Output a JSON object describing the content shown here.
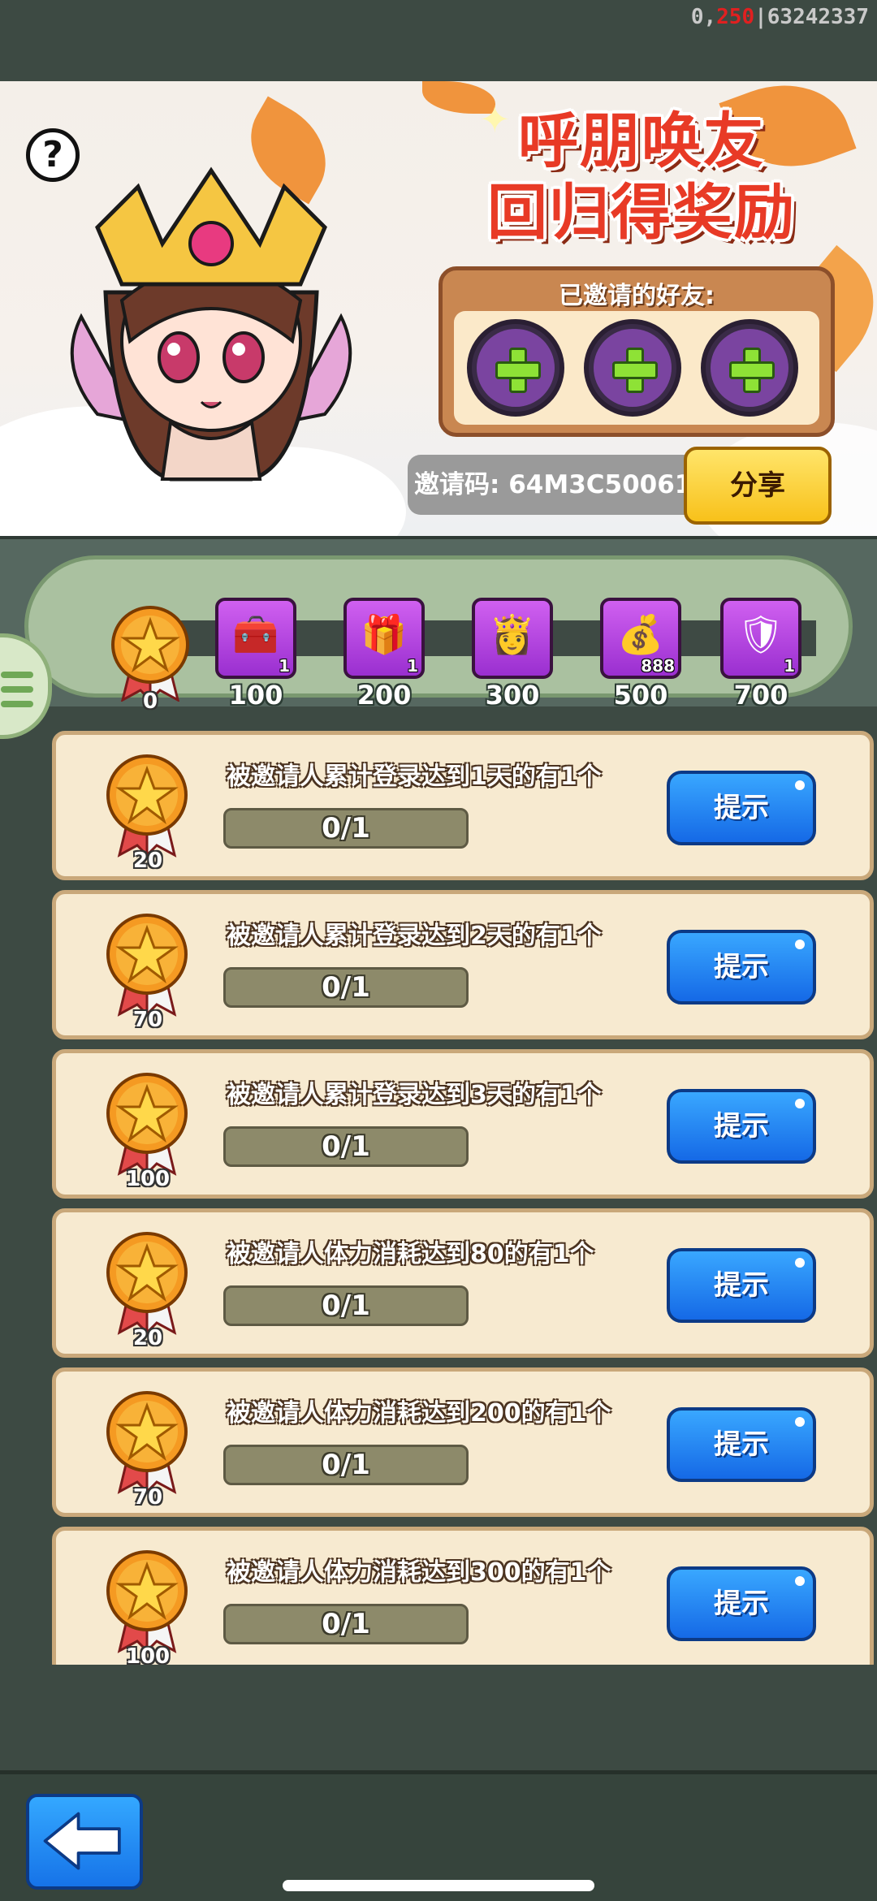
{
  "status": {
    "debug_prefix": "0,",
    "debug_red": "250",
    "debug_suffix": "|63242337"
  },
  "banner": {
    "title_line1": "呼朋唤友",
    "title_line2": "回归得奖励",
    "help_label": "?",
    "friends_title": "已邀请的好友:",
    "invite_code_label": "邀请码:",
    "invite_code_value": "64M3C50061",
    "share_label": "分享"
  },
  "track": {
    "current_points": "0",
    "rewards": [
      {
        "icon": "chest-upgrade-icon",
        "qty": "1",
        "threshold": "100"
      },
      {
        "icon": "chest-arrow-icon",
        "qty": "1",
        "threshold": "200"
      },
      {
        "icon": "hero-portrait-icon",
        "qty": "",
        "threshold": "300"
      },
      {
        "icon": "gold-ingot-icon",
        "qty": "888",
        "threshold": "500"
      },
      {
        "icon": "armor-icon",
        "qty": "1",
        "threshold": "700"
      }
    ]
  },
  "tasks": [
    {
      "desc": "被邀请人累计登录达到1天的有1个",
      "progress": "0/1",
      "reward": "20",
      "button": "提示"
    },
    {
      "desc": "被邀请人累计登录达到2天的有1个",
      "progress": "0/1",
      "reward": "70",
      "button": "提示"
    },
    {
      "desc": "被邀请人累计登录达到3天的有1个",
      "progress": "0/1",
      "reward": "100",
      "button": "提示"
    },
    {
      "desc": "被邀请人体力消耗达到80的有1个",
      "progress": "0/1",
      "reward": "20",
      "button": "提示"
    },
    {
      "desc": "被邀请人体力消耗达到200的有1个",
      "progress": "0/1",
      "reward": "70",
      "button": "提示"
    },
    {
      "desc": "被邀请人体力消耗达到300的有1个",
      "progress": "0/1",
      "reward": "100",
      "button": "提示"
    }
  ],
  "colors": {
    "accent_blue": "#1a7ff0",
    "accent_yellow": "#f8c11a",
    "title_red": "#e83a26"
  }
}
